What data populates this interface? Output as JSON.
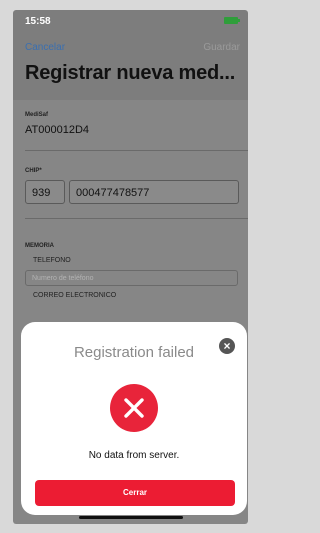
{
  "status_bar": {
    "time": "15:58"
  },
  "nav": {
    "cancel_label": "Cancelar",
    "save_label": "Guardar",
    "title": "Registrar nueva med..."
  },
  "form": {
    "medisafe_label": "MediSaf",
    "medisafe_value": "AT000012D4",
    "chip_label": "CHIP*",
    "chip_prefix": "939",
    "chip_number": "000477478577",
    "memoria_label": "MEMORIA",
    "telefono_label": "TELEFONO",
    "telefono_placeholder": "Numero de teléfono",
    "correo_label": "CORREO ELECTRONICO"
  },
  "modal": {
    "title": "Registration failed",
    "message": "No data from server.",
    "button_label": "Cerrar",
    "close_symbol": "×",
    "colors": {
      "accent": "#e8243a",
      "button": "#ec1c33"
    }
  }
}
